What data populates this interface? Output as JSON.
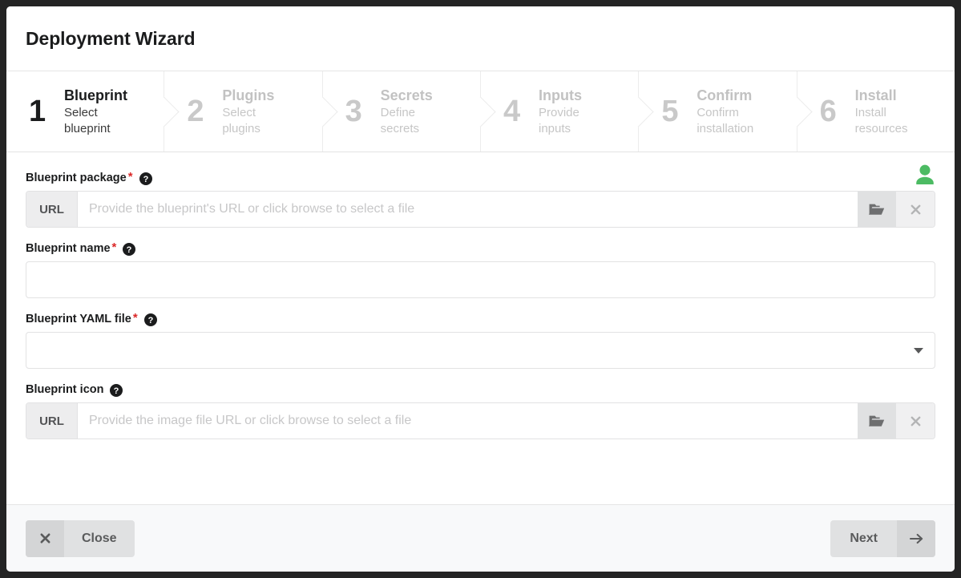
{
  "window": {
    "title": "Deployment Wizard"
  },
  "steps": [
    {
      "num": "1",
      "title": "Blueprint",
      "desc": "Select blueprint",
      "active": true
    },
    {
      "num": "2",
      "title": "Plugins",
      "desc": "Select plugins",
      "active": false
    },
    {
      "num": "3",
      "title": "Secrets",
      "desc": "Define secrets",
      "active": false
    },
    {
      "num": "4",
      "title": "Inputs",
      "desc": "Provide inputs",
      "active": false
    },
    {
      "num": "5",
      "title": "Confirm",
      "desc": "Confirm installation",
      "active": false
    },
    {
      "num": "6",
      "title": "Install",
      "desc": "Install resources",
      "active": false
    }
  ],
  "form": {
    "blueprint_package": {
      "label": "Blueprint package",
      "required_marker": "*",
      "help_icon": "question-circle-icon",
      "prefix": "URL",
      "value": "",
      "placeholder": "Provide the blueprint's URL or click browse to select a file",
      "browse_icon": "folder-open-icon",
      "clear_icon": "close-icon"
    },
    "blueprint_name": {
      "label": "Blueprint name",
      "required_marker": "*",
      "help_icon": "question-circle-icon",
      "value": "",
      "placeholder": ""
    },
    "blueprint_yaml_file": {
      "label": "Blueprint YAML file",
      "required_marker": "*",
      "help_icon": "question-circle-icon",
      "selected": "",
      "caret_icon": "chevron-down-icon"
    },
    "blueprint_icon": {
      "label": "Blueprint icon",
      "help_icon": "question-circle-icon",
      "prefix": "URL",
      "value": "",
      "placeholder": "Provide the image file URL or click browse to select a file",
      "browse_icon": "folder-open-icon",
      "clear_icon": "close-icon"
    }
  },
  "body": {
    "user_icon": "user-icon"
  },
  "footer": {
    "close_label": "Close",
    "close_icon": "close-icon",
    "next_label": "Next",
    "next_icon": "arrow-right-icon"
  },
  "colors": {
    "accent_green": "#4cbb63",
    "required_red": "#db2828",
    "backdrop": "#242424"
  }
}
